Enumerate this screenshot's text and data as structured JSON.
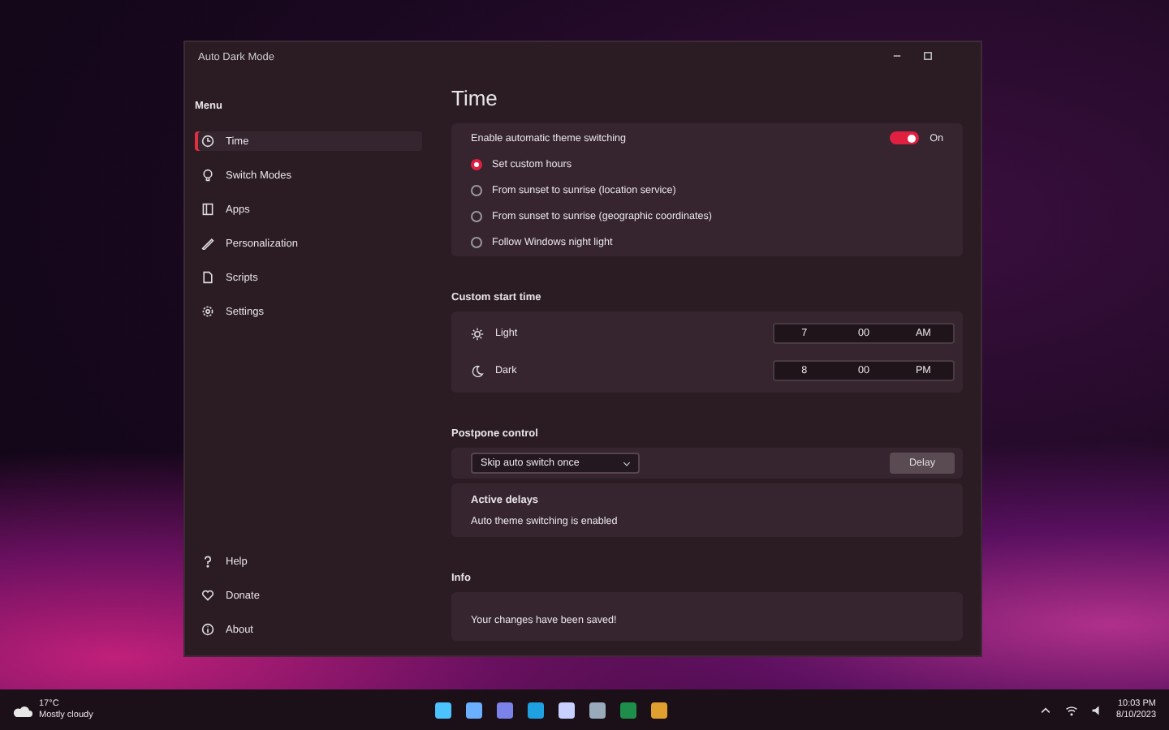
{
  "window": {
    "title": "Auto Dark Mode"
  },
  "sidebar": {
    "heading": "Menu",
    "items": [
      {
        "label": "Time",
        "selected": true
      },
      {
        "label": "Switch Modes",
        "selected": false
      },
      {
        "label": "Apps",
        "selected": false
      },
      {
        "label": "Personalization",
        "selected": false
      },
      {
        "label": "Scripts",
        "selected": false
      },
      {
        "label": "Settings",
        "selected": false
      }
    ],
    "footer_items": [
      {
        "label": "Help",
        "selected": false
      },
      {
        "label": "Donate",
        "selected": false
      },
      {
        "label": "About",
        "selected": false
      }
    ]
  },
  "page": {
    "title": "Time"
  },
  "auto_switch": {
    "label": "Enable automatic theme switching",
    "on": true,
    "state_label": "On"
  },
  "modes": [
    {
      "label": "Set custom hours",
      "selected": true
    },
    {
      "label": "From sunset to sunrise (location service)",
      "selected": false
    },
    {
      "label": "From sunset to sunrise (geographic coordinates)",
      "selected": false
    },
    {
      "label": "Follow Windows night light",
      "selected": false
    }
  ],
  "custom_start": {
    "heading": "Custom start time",
    "rows": [
      {
        "label": "Light",
        "hour": "7",
        "minute": "00",
        "period": "AM"
      },
      {
        "label": "Dark",
        "hour": "8",
        "minute": "00",
        "period": "PM"
      }
    ]
  },
  "postpone": {
    "heading": "Postpone control",
    "dropdown": "Skip auto switch once",
    "button": "Delay",
    "active_heading": "Active delays",
    "active_text": "Auto theme switching is enabled"
  },
  "info": {
    "heading": "Info",
    "text": "Your changes have been saved!"
  },
  "taskbar": {
    "weather_temp": "17°C",
    "weather_text": "Mostly cloudy",
    "time": "10:03 PM",
    "date": "8/10/2023"
  }
}
